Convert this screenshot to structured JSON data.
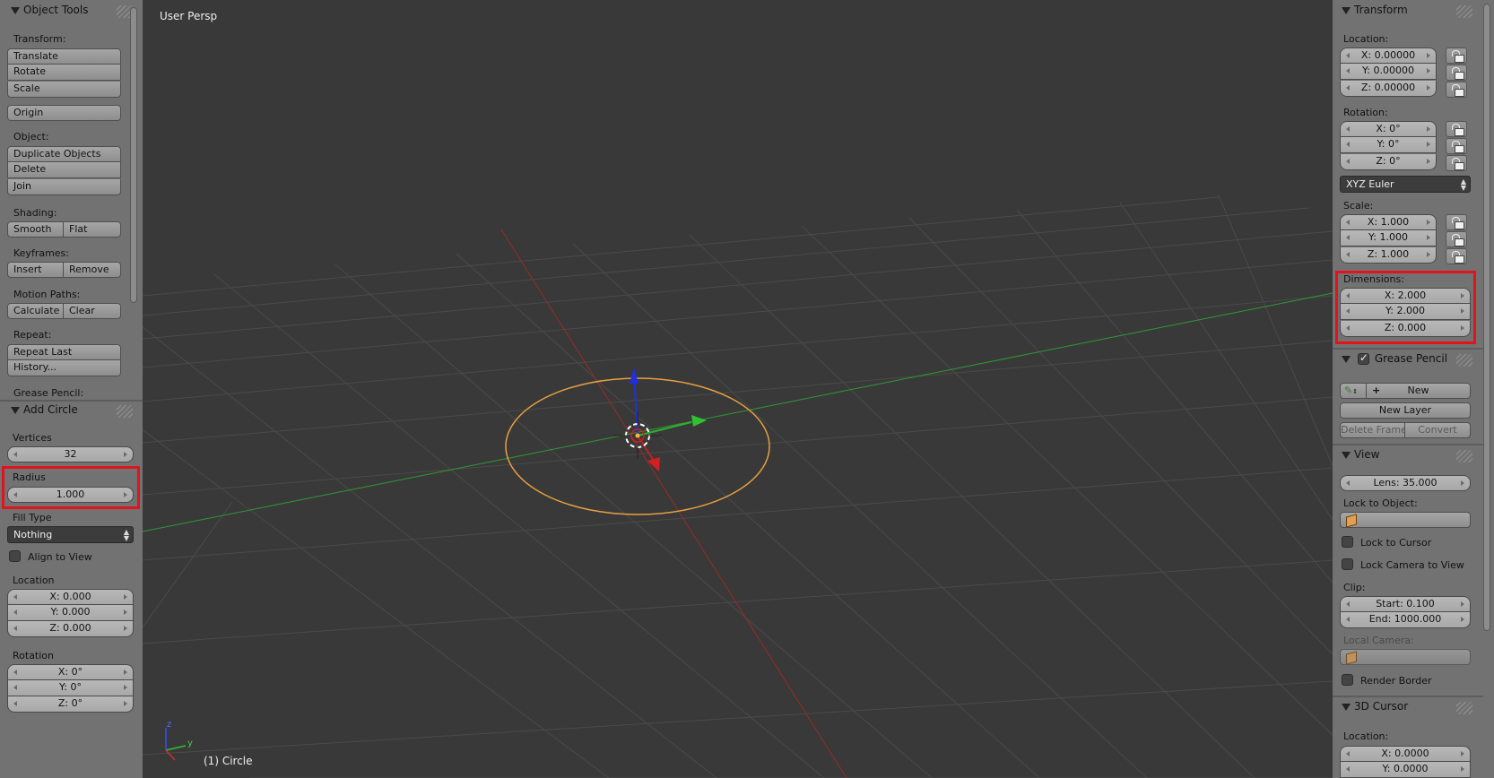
{
  "left": {
    "object_tools": {
      "title": "Object Tools",
      "transform_label": "Transform:",
      "translate": "Translate",
      "rotate": "Rotate",
      "scale": "Scale",
      "origin": "Origin",
      "object_label": "Object:",
      "duplicate": "Duplicate Objects",
      "delete": "Delete",
      "join": "Join",
      "shading_label": "Shading:",
      "smooth": "Smooth",
      "flat": "Flat",
      "keyframes_label": "Keyframes:",
      "insert": "Insert",
      "remove": "Remove",
      "motion_label": "Motion Paths:",
      "calculate": "Calculate",
      "clear": "Clear",
      "repeat_label": "Repeat:",
      "repeat_last": "Repeat Last",
      "history": "History...",
      "grease_label": "Grease Pencil:"
    },
    "add_circle": {
      "title": "Add Circle",
      "vertices_label": "Vertices",
      "vertices": "32",
      "radius_label": "Radius",
      "radius": "1.000",
      "fill_label": "Fill Type",
      "fill_value": "Nothing",
      "align_label": "Align to View",
      "location_label": "Location",
      "loc_x": "X: 0.000",
      "loc_y": "Y: 0.000",
      "loc_z": "Z: 0.000",
      "rotation_label": "Rotation",
      "rot_x": "X: 0°",
      "rot_y": "Y: 0°",
      "rot_z": "Z: 0°"
    }
  },
  "viewport": {
    "view_name": "User Persp",
    "object_info": "(1) Circle",
    "axis_z": "z",
    "axis_y": "y"
  },
  "right": {
    "transform": {
      "title": "Transform",
      "location_label": "Location:",
      "loc_x": "X: 0.00000",
      "loc_y": "Y: 0.00000",
      "loc_z": "Z: 0.00000",
      "rotation_label": "Rotation:",
      "rot_x": "X: 0°",
      "rot_y": "Y: 0°",
      "rot_z": "Z: 0°",
      "rotation_mode": "XYZ Euler",
      "scale_label": "Scale:",
      "scale_x": "X: 1.000",
      "scale_y": "Y: 1.000",
      "scale_z": "Z: 1.000",
      "dimensions_label": "Dimensions:",
      "dim_x": "X: 2.000",
      "dim_y": "Y: 2.000",
      "dim_z": "Z: 0.000"
    },
    "grease_pencil": {
      "title": "Grease Pencil",
      "new": "New",
      "new_layer": "New Layer",
      "delete_frame": "Delete Frame",
      "convert": "Convert"
    },
    "view": {
      "title": "View",
      "lens": "Lens: 35.000",
      "lock_object_label": "Lock to Object:",
      "lock_cursor": "Lock to Cursor",
      "lock_camera": "Lock Camera to View",
      "clip_label": "Clip:",
      "clip_start": "Start: 0.100",
      "clip_end": "End: 1000.000",
      "local_camera_label": "Local Camera:",
      "render_border": "Render Border"
    },
    "cursor": {
      "title": "3D Cursor",
      "location_label": "Location:",
      "x": "X: 0.0000",
      "y": "Y: 0.0000"
    }
  },
  "colors": {
    "highlight": "#e2131c",
    "circle": "#e8a040",
    "x_axis": "#b02020",
    "y_axis": "#30a030",
    "z_axis": "#2030e0"
  }
}
